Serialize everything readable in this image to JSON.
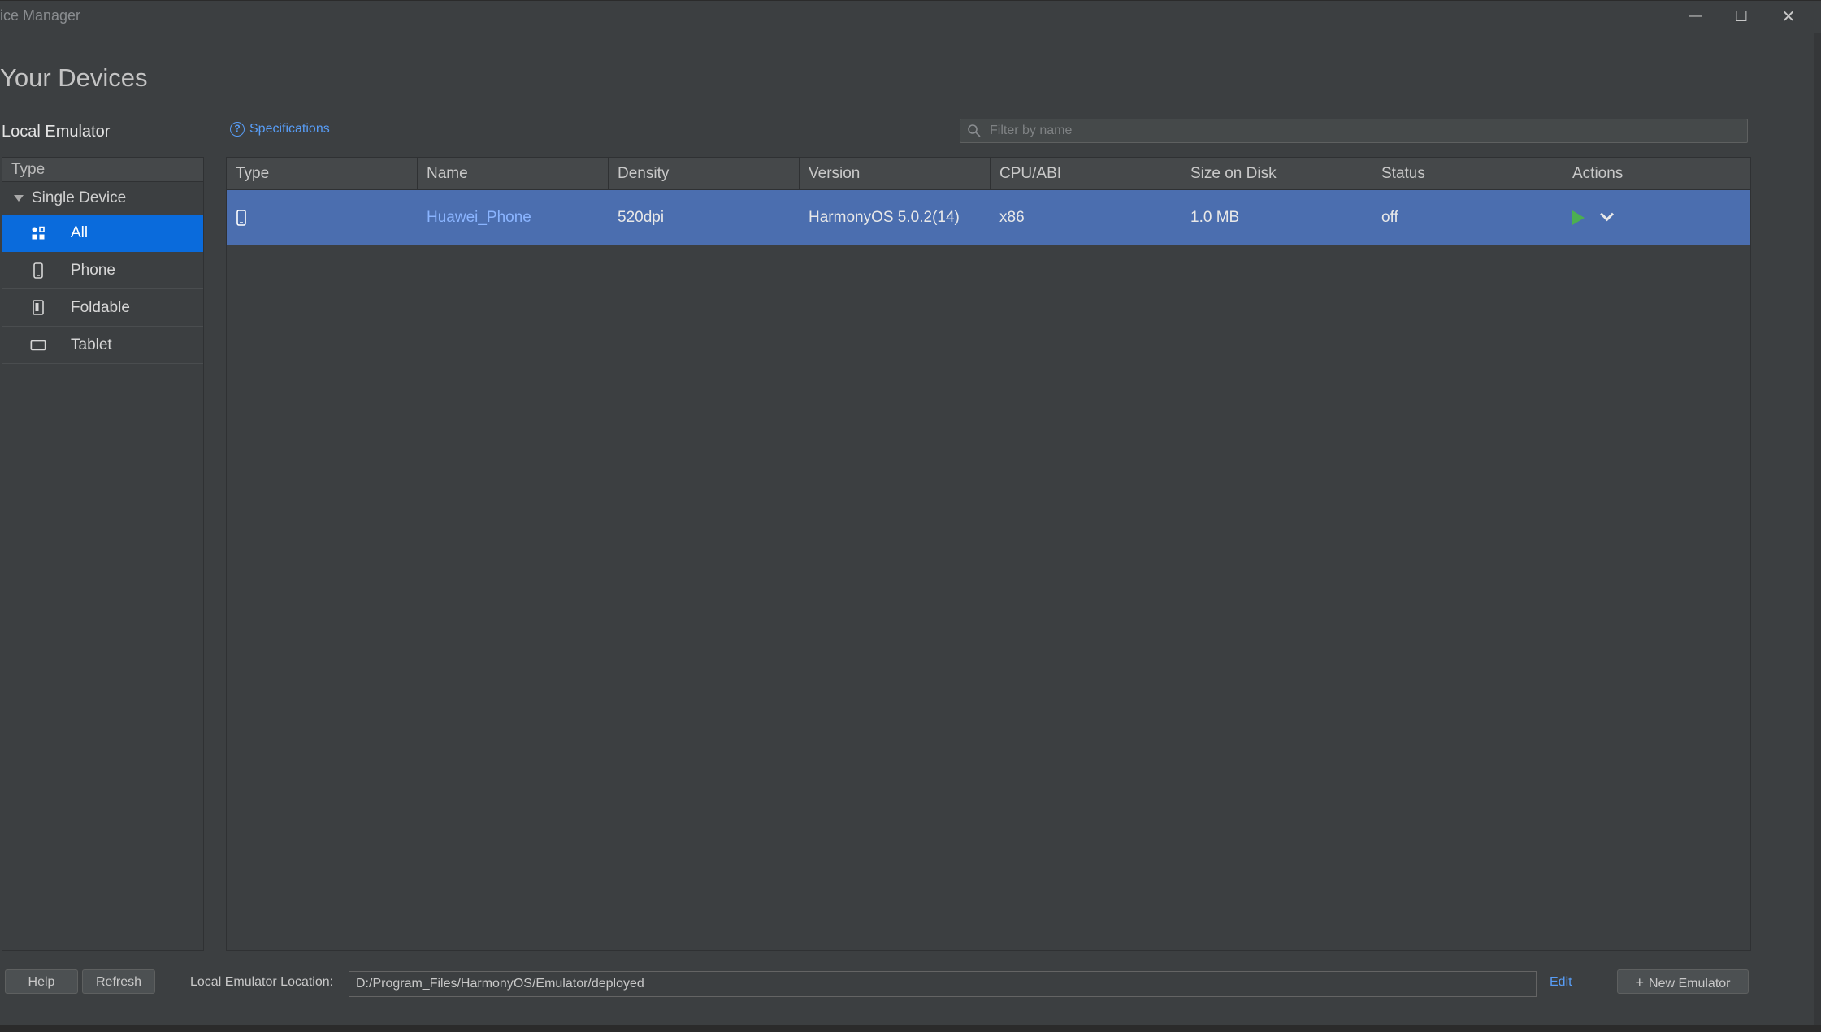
{
  "window": {
    "title": "ice Manager",
    "minimize_glyph": "—",
    "maximize_glyph": "☐",
    "close_glyph": "✕"
  },
  "heading": "Your Devices",
  "section": "Local Emulator",
  "specifications_link": "Specifications",
  "filter": {
    "placeholder": "Filter by name",
    "value": ""
  },
  "sidebar": {
    "header": "Type",
    "group": "Single Device",
    "items": [
      {
        "label": "All",
        "icon": "grid-icon",
        "selected": true
      },
      {
        "label": "Phone",
        "icon": "phone-icon",
        "selected": false
      },
      {
        "label": "Foldable",
        "icon": "foldable-icon",
        "selected": false
      },
      {
        "label": "Tablet",
        "icon": "tablet-icon",
        "selected": false
      }
    ]
  },
  "table": {
    "columns": [
      "Type",
      "Name",
      "Density",
      "Version",
      "CPU/ABI",
      "Size on Disk",
      "Status",
      "Actions"
    ],
    "rows": [
      {
        "type_icon": "phone-icon",
        "name": "Huawei_Phone",
        "density": "520dpi",
        "version": "HarmonyOS 5.0.2(14)",
        "cpu": "x86",
        "size": "1.0 MB",
        "status": "off"
      }
    ]
  },
  "footer": {
    "help": "Help",
    "refresh": "Refresh",
    "location_label": "Local Emulator Location:",
    "location_value": "D:/Program_Files/HarmonyOS/Emulator/deployed",
    "edit": "Edit",
    "new_emulator": "New Emulator"
  },
  "colors": {
    "background": "#3c3f41",
    "selected_sidebar": "#0a6bdc",
    "selected_row": "#4b6eaf",
    "link": "#589df6",
    "play": "#4caf50"
  }
}
